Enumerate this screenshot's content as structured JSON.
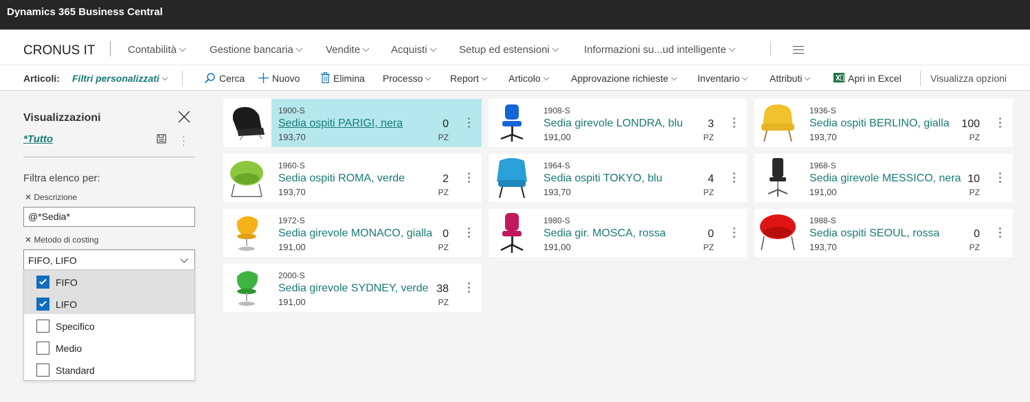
{
  "app": {
    "title": "Dynamics 365 Business Central"
  },
  "nav": {
    "company": "CRONUS IT",
    "items": [
      {
        "label": "Contabilità"
      },
      {
        "label": "Gestione bancaria"
      },
      {
        "label": "Vendite"
      },
      {
        "label": "Acquisti"
      },
      {
        "label": "Setup ed estensioni"
      },
      {
        "label": "Informazioni su...ud intelligente"
      }
    ]
  },
  "actions": {
    "entity": "Articoli:",
    "filter_label": "Filtri personalizzati",
    "search": "Cerca",
    "new": "Nuovo",
    "delete": "Elimina",
    "process": "Processo",
    "report": "Report",
    "item": "Articolo",
    "approval": "Approvazione richieste",
    "inventory": "Inventario",
    "attributes": "Attributi",
    "excel": "Apri in Excel",
    "view_options": "Visualizza opzioni"
  },
  "filter_pane": {
    "title": "Visualizzazioni",
    "view": "*Tutto",
    "filter_by": "Filtra elenco per:",
    "field1_label": "Descrizione",
    "field1_value": "@*Sedia*",
    "field2_label": "Metodo di costing",
    "field2_value": "FIFO, LIFO",
    "options": [
      {
        "label": "FIFO",
        "checked": true
      },
      {
        "label": "LIFO",
        "checked": true
      },
      {
        "label": "Specifico",
        "checked": false
      },
      {
        "label": "Medio",
        "checked": false
      },
      {
        "label": "Standard",
        "checked": false
      }
    ]
  },
  "colors": {
    "accent": "#187a75",
    "selected_tile": "#b5e8ec",
    "topbar": "#262626",
    "checkbox": "#106ebe"
  },
  "tiles": [
    {
      "no": "1900-S",
      "desc": "Sedia ospiti PARIGI, nera",
      "price": "193,70",
      "qty": "0",
      "uom": "PZ",
      "chair": "black-lounge",
      "selected": true
    },
    {
      "no": "1908-S",
      "desc": "Sedia girevole LONDRA, blu",
      "price": "191,00",
      "qty": "3",
      "uom": "PZ",
      "chair": "blue-office"
    },
    {
      "no": "1936-S",
      "desc": "Sedia ospiti BERLINO, gialla",
      "price": "193,70",
      "qty": "100",
      "uom": "PZ",
      "chair": "yellow-armchair"
    },
    {
      "no": "1960-S",
      "desc": "Sedia ospiti ROMA, verde",
      "price": "193,70",
      "qty": "2",
      "uom": "PZ",
      "chair": "green-tub"
    },
    {
      "no": "1964-S",
      "desc": "Sedia ospiti TOKYO, blu",
      "price": "193,70",
      "qty": "4",
      "uom": "PZ",
      "chair": "blue-wing"
    },
    {
      "no": "1968-S",
      "desc": "Sedia girevole MESSICO, nera",
      "price": "191,00",
      "qty": "10",
      "uom": "PZ",
      "chair": "black-office"
    },
    {
      "no": "1972-S",
      "desc": "Sedia girevole MONACO, gialla",
      "price": "191,00",
      "qty": "0",
      "uom": "PZ",
      "chair": "yellow-egg"
    },
    {
      "no": "1980-S",
      "desc": "Sedia gir. MOSCA, rossa",
      "price": "191,00",
      "qty": "0",
      "uom": "PZ",
      "chair": "red-office"
    },
    {
      "no": "1988-S",
      "desc": "Sedia ospiti SEOUL, rossa",
      "price": "193,70",
      "qty": "0",
      "uom": "PZ",
      "chair": "red-tub"
    },
    {
      "no": "2000-S",
      "desc": "Sedia girevole SYDNEY, verde",
      "price": "191,00",
      "qty": "38",
      "uom": "PZ",
      "chair": "green-egg"
    }
  ]
}
